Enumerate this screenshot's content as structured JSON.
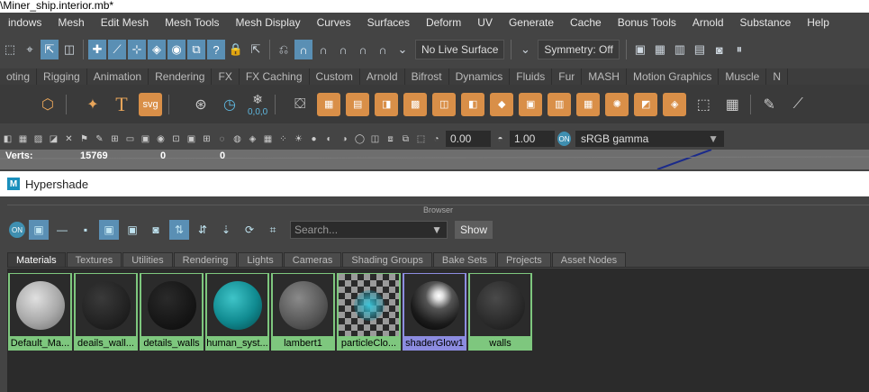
{
  "window": {
    "title": "\\Miner_ship.interior.mb*"
  },
  "menubar": [
    "indows",
    "Mesh",
    "Edit Mesh",
    "Mesh Tools",
    "Mesh Display",
    "Curves",
    "Surfaces",
    "Deform",
    "UV",
    "Generate",
    "Cache",
    "Bonus Tools",
    "Arnold",
    "Substance",
    "Help"
  ],
  "statusline": {
    "live_surface": "No Live Surface",
    "symmetry": "Symmetry: Off"
  },
  "shelf_tabs": [
    "oting",
    "Rigging",
    "Animation",
    "Rendering",
    "FX",
    "FX Caching",
    "Custom",
    "Arnold",
    "Bifrost",
    "Dynamics",
    "Fluids",
    "Fur",
    "MASH",
    "Motion Graphics",
    "Muscle",
    "N"
  ],
  "shelf_icons": [
    "icosahedron-icon",
    "star-icon",
    "text-icon",
    "svg-icon",
    "snap-icon",
    "clock-icon",
    "snowflake-icon"
  ],
  "shelf_labels": {
    "text": "T",
    "svg": "svg",
    "origin": "0,0,0"
  },
  "panel_toolbar": {
    "exposure": "0.00",
    "gamma": "1.00",
    "colorspace": "sRGB gamma"
  },
  "hud": {
    "label": "Verts:",
    "v1": "15769",
    "v2": "0",
    "v3": "0"
  },
  "hypershade": {
    "title": "Hypershade",
    "browser_label": "Browser",
    "search_placeholder": "Search...",
    "show_label": "Show",
    "tabs": [
      "Materials",
      "Textures",
      "Utilities",
      "Rendering",
      "Lights",
      "Cameras",
      "Shading Groups",
      "Bake Sets",
      "Projects",
      "Asset Nodes"
    ],
    "active_tab": "Materials",
    "materials": [
      {
        "label": "Default_Ma...",
        "preview": "light-gray-sphere"
      },
      {
        "label": "deails_wall...",
        "preview": "dark-sphere"
      },
      {
        "label": "details_walls",
        "preview": "black-sphere"
      },
      {
        "label": "human_syst...",
        "preview": "teal-sphere"
      },
      {
        "label": "lambert1",
        "preview": "gray-sphere"
      },
      {
        "label": "particleClo...",
        "preview": "checker-glow"
      },
      {
        "label": "shaderGlow1",
        "preview": "glossy-sphere",
        "selected": true
      },
      {
        "label": "walls",
        "preview": "charcoal-sphere"
      }
    ]
  },
  "colors": {
    "selected_green": "#7ec77e",
    "selected_blue": "#8c8ce0",
    "accent": "#5a8fb4",
    "shelf_orange": "#d98f48"
  }
}
